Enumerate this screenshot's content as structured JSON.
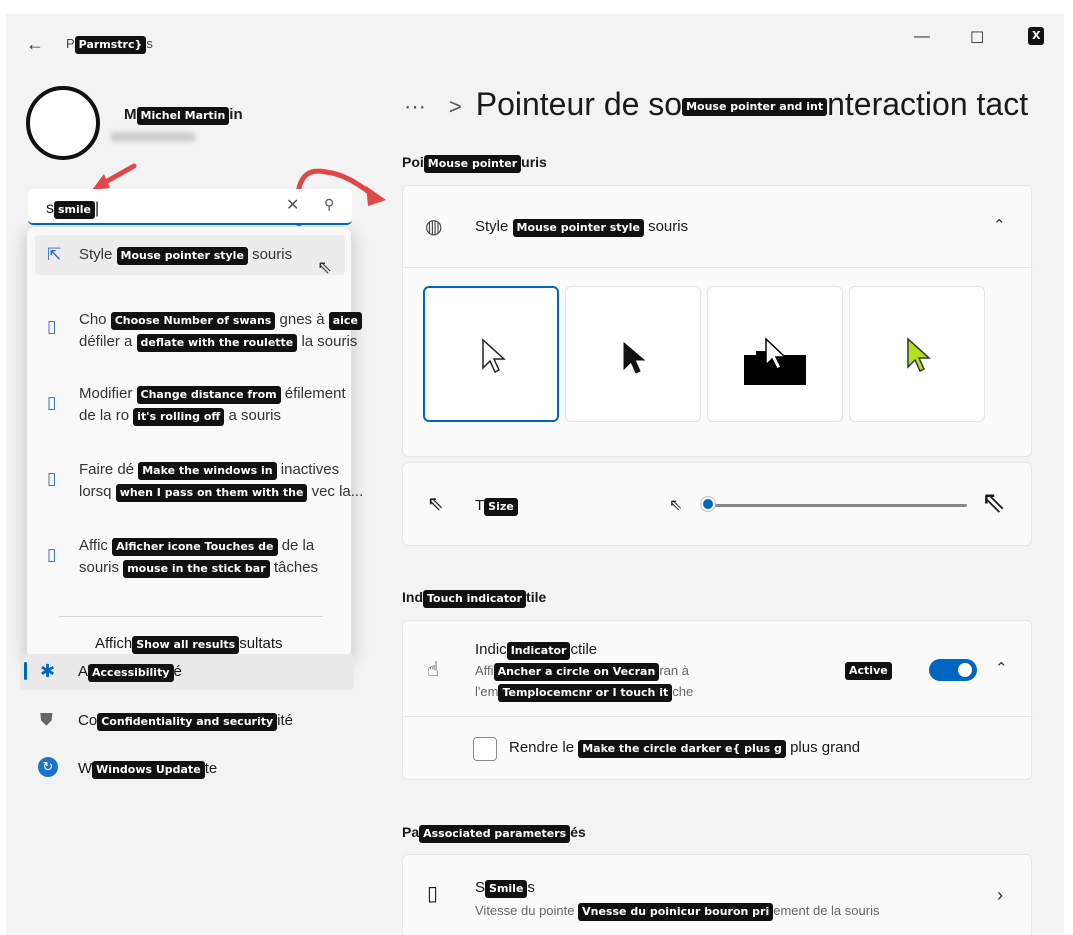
{
  "window": {
    "title": "Parmstrc}",
    "minimize_glyph": "—",
    "maximize_glyph": "☐",
    "close_label": "X"
  },
  "user": {
    "name": "Michel Martin"
  },
  "search": {
    "value": "smile"
  },
  "search_results": [
    {
      "icon": "mouse-pointer-icon",
      "line1_prefix": "Style",
      "line1_tag": "Mouse pointer style",
      "line1_suffix": "souris",
      "line2_prefix": "",
      "line2_tag": "",
      "line2_suffix": ""
    },
    {
      "icon": "mouse-icon",
      "line1_prefix": "Cho",
      "line1_tag": "Choose Number of swans",
      "line1_suffix": "gnes à",
      "line1_tag2": "aice",
      "line2_prefix": "défiler a",
      "line2_tag": "deflate with the roulette",
      "line2_suffix": "la souris"
    },
    {
      "icon": "mouse-icon",
      "line1_prefix": "Modifier",
      "line1_tag": "Change distance from",
      "line1_suffix": "éfilement",
      "line2_prefix": "de la ro",
      "line2_tag": "it's rolling off",
      "line2_suffix": "a souris"
    },
    {
      "icon": "mouse-icon",
      "line1_prefix": "Faire dé",
      "line1_tag": "Make the windows in",
      "line1_suffix": "inactives",
      "line2_prefix": "lorsq",
      "line2_tag": "when I pass on them with the",
      "line2_suffix": "vec la..."
    },
    {
      "icon": "mouse-icon",
      "line1_prefix": "Affic",
      "line1_tag": "Alficher icone Touches de",
      "line1_suffix": "de la",
      "line2_prefix": "souris",
      "line2_tag": "mouse in the stick bar",
      "line2_suffix": "tâches"
    }
  ],
  "search_all": {
    "prefix": "Affich",
    "tag": "Show all results",
    "suffix": "sultats"
  },
  "nav": [
    {
      "icon": "accessibility-icon",
      "prefix": "A",
      "tag": "Accessibility",
      "suffix": "é"
    },
    {
      "icon": "shield-icon",
      "prefix": "Co",
      "tag": "Confidentiality and security",
      "suffix": "ité"
    },
    {
      "icon": "windows-update-icon",
      "prefix": "W",
      "tag": "Windows Update",
      "suffix": "te"
    }
  ],
  "breadcrumb": {
    "ellipsis": "···",
    "separator": ">",
    "prefix": "Pointeur de so",
    "tag": "Mouse pointer and int",
    "suffix": "nteraction tact"
  },
  "pointer_section": {
    "heading_prefix": "Poi",
    "heading_tag": "Mouse pointer",
    "heading_suffix": "uris",
    "style_prefix": "Style",
    "style_tag": "Mouse pointer style",
    "style_suffix": "souris",
    "size_tag": "Size",
    "size_value": 0.0
  },
  "touch_section": {
    "heading_prefix": "Ind",
    "heading_tag": "Touch indicator",
    "heading_suffix": "tile",
    "title_prefix": "Indic",
    "title_tag": "Indicator",
    "title_suffix": "ctile",
    "desc1_prefix": "Affi",
    "desc1_tag": "Ancher a circle on Vecran",
    "desc1_suffix": "ran à",
    "desc2_prefix": "l'em",
    "desc2_tag": "Templocemcnr or I touch it",
    "desc2_suffix": "che",
    "toggle_tag": "Active",
    "toggle_on": true,
    "check_prefix": "Rendre le",
    "check_tag": "Make the circle darker e{ plus g",
    "check_suffix": "plus grand",
    "checked": false
  },
  "related": {
    "heading_prefix": "Pa",
    "heading_tag": "Associated parameters",
    "heading_suffix": "és",
    "item_tag": "Smile",
    "item_title_prefix": "S",
    "item_title_suffix": "s",
    "desc_prefix": "Vitesse du pointe",
    "desc_tag": "Vnesse du poinicur bouron pri",
    "desc_suffix": "ement de la souris"
  }
}
